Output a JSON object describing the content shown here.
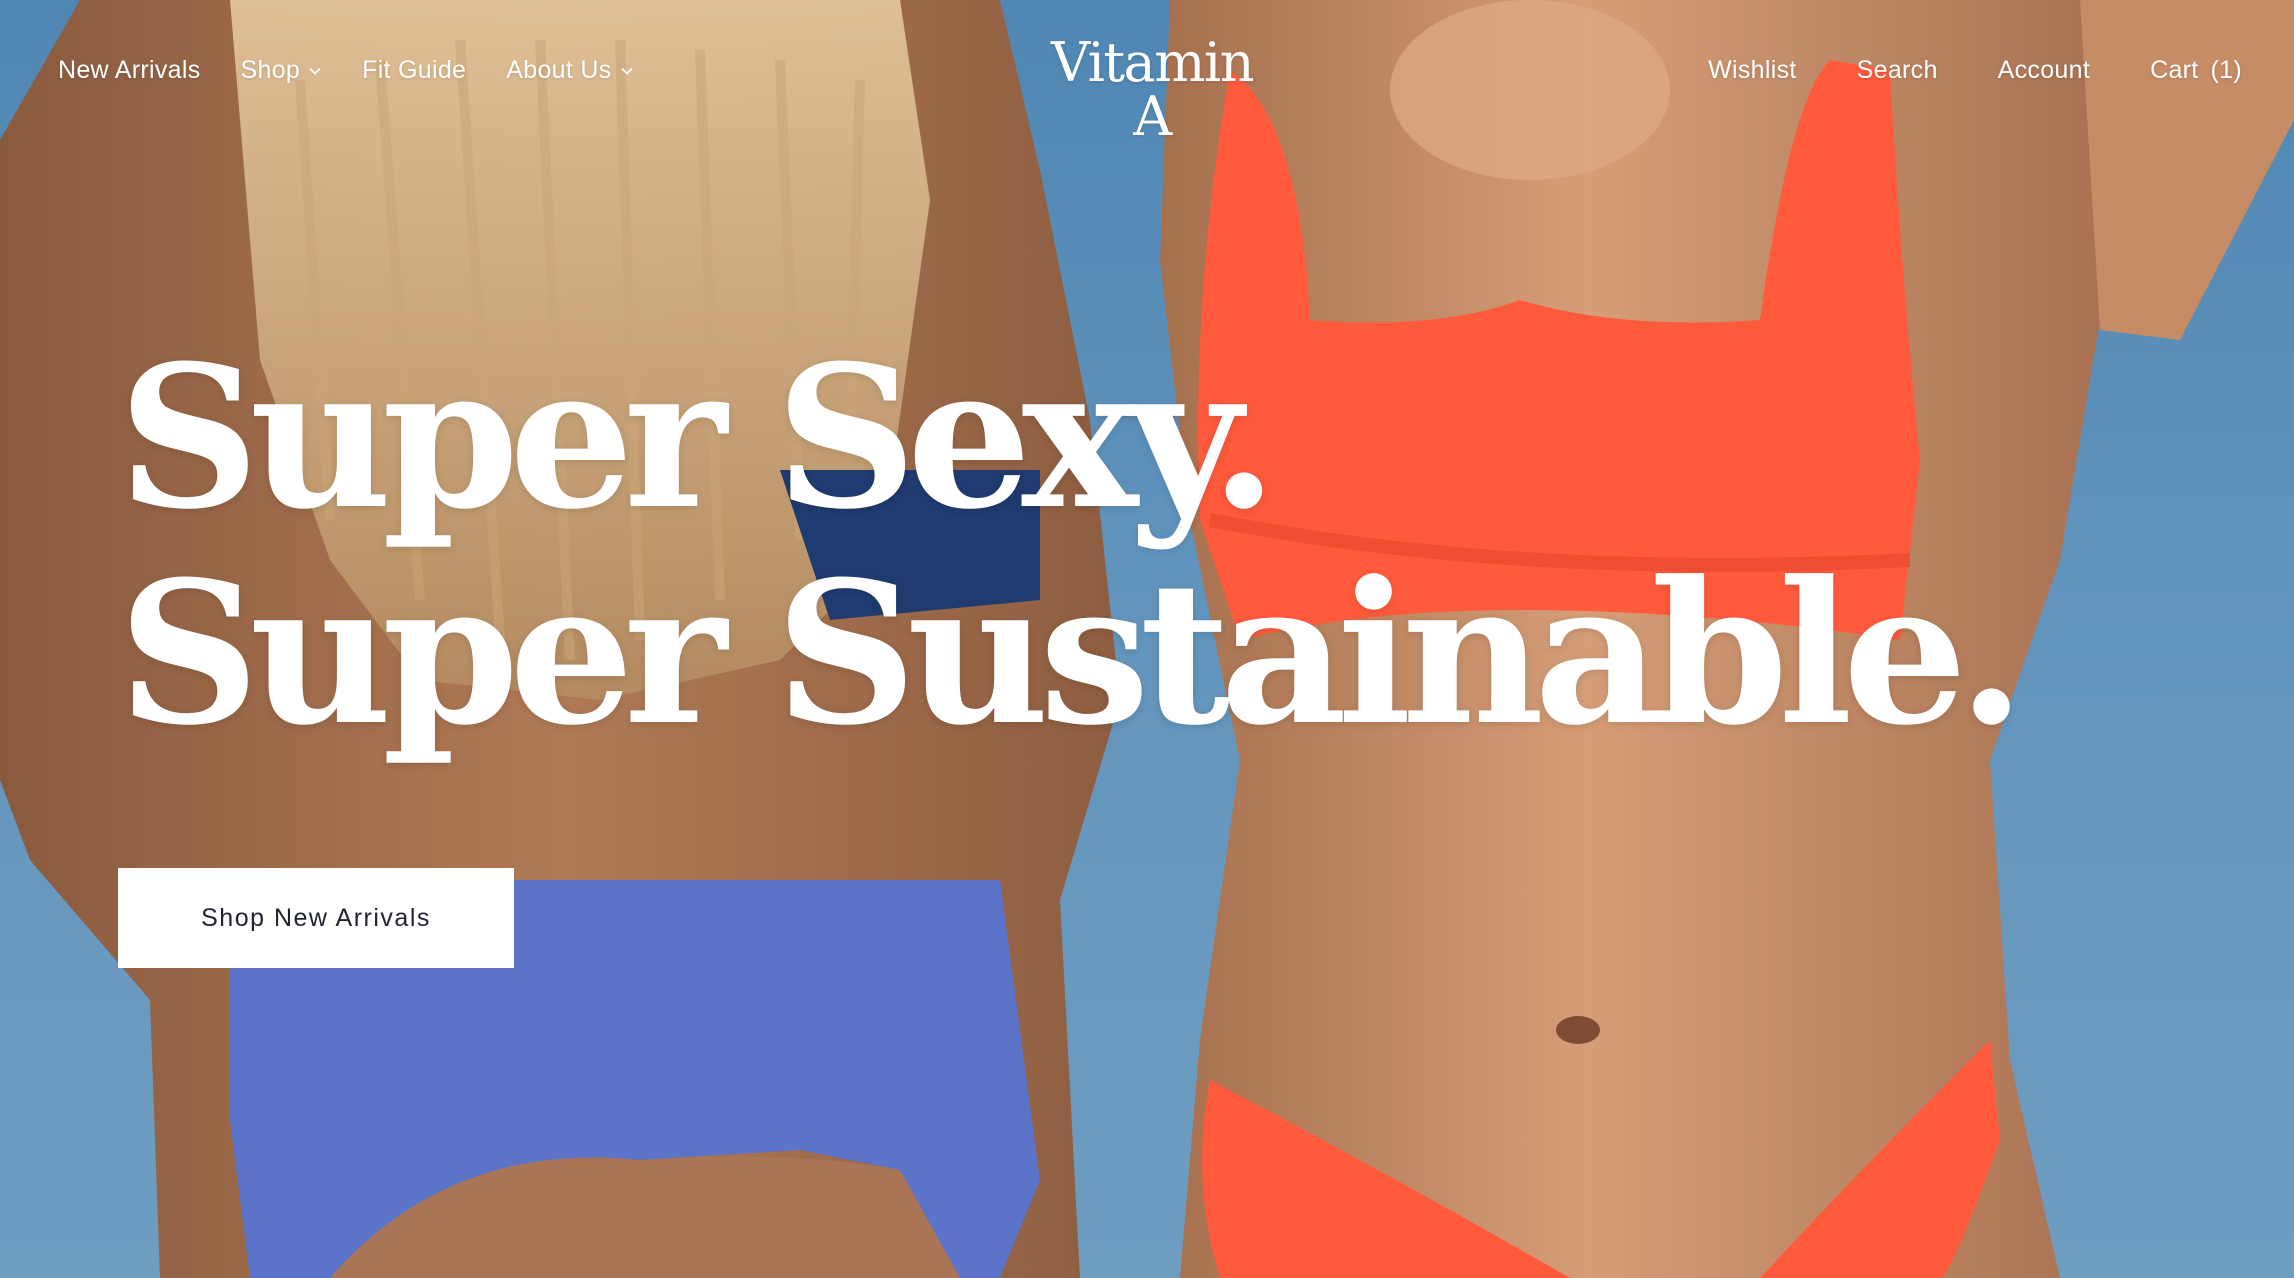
{
  "header": {
    "logo_text": "Vitamin A",
    "nav_left": [
      {
        "label": "New Arrivals",
        "has_dropdown": false
      },
      {
        "label": "Shop",
        "has_dropdown": true
      },
      {
        "label": "Fit Guide",
        "has_dropdown": false
      },
      {
        "label": "About Us",
        "has_dropdown": true
      }
    ],
    "nav_right": {
      "wishlist_label": "Wishlist",
      "search_label": "Search",
      "account_label": "Account",
      "cart_label": "Cart",
      "cart_count": "(1)"
    }
  },
  "hero": {
    "headline_line1": "Super Sexy.",
    "headline_line2": "Super Sustainable.",
    "cta_label": "Shop New Arrivals"
  },
  "colors": {
    "sky": "#5e8fb6",
    "cta_background": "#ffffff",
    "cta_text": "#1f2233",
    "text": "#ffffff",
    "swim_orange": "#ff5a3c",
    "swim_blue": "#5b73c9"
  }
}
